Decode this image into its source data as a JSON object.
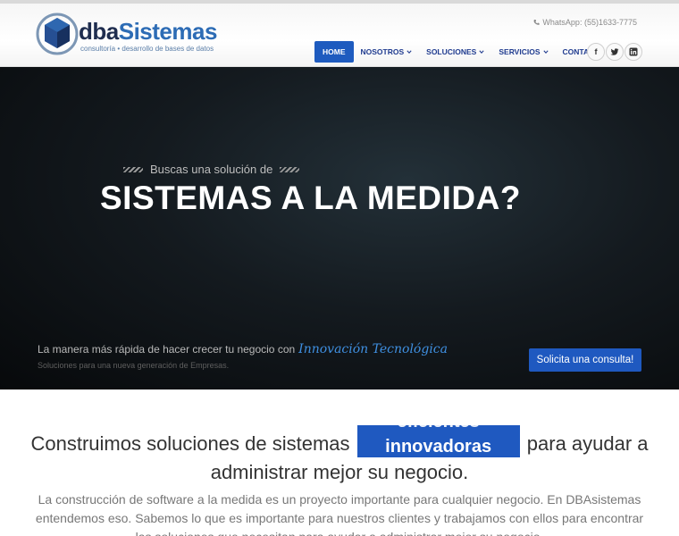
{
  "header": {
    "logo": {
      "name_part1": "dba",
      "name_part2": "Sistemas",
      "tagline": "consultoría • desarrollo de bases de datos"
    },
    "whatsapp_text": "WhatsApp: (55)1633-7775",
    "nav": {
      "items": [
        {
          "label": "HOME",
          "active": true,
          "dropdown": false
        },
        {
          "label": "NOSOTROS",
          "active": false,
          "dropdown": true
        },
        {
          "label": "SOLUCIONES",
          "active": false,
          "dropdown": true
        },
        {
          "label": "SERVICIOS",
          "active": false,
          "dropdown": true
        },
        {
          "label": "CONTACTO",
          "active": false,
          "dropdown": true
        }
      ]
    },
    "social": {
      "facebook": "f",
      "twitter": "t",
      "linkedin": "in"
    }
  },
  "hero": {
    "pre_title": "Buscas una solución de",
    "title": "SISTEMAS A LA MEDIDA?",
    "line": "La manera más rápida de hacer crecer tu negocio con",
    "line_script": "Innovación Tecnológica",
    "subline": "Soluciones para una nueva generación de Empresas.",
    "cta_label": "Solicita una consulta!"
  },
  "intro": {
    "lead_before": "Construimos soluciones de sistemas",
    "rotating_prev": "eficientes",
    "rotating_word": "innovadoras",
    "lead_after": "para ayudar a",
    "lead_line2": "administrar mejor su negocio.",
    "body": "La construcción de software a la medida es un proyecto importante para cualquier negocio. En DBAsistemas entendemos eso. Sabemos lo que es importante para nuestros clientes y trabajamos con ellos para encontrar las soluciones que necesitan para ayudar a administrar mejor su negocio."
  },
  "colors": {
    "brand_blue": "#1f59c0",
    "nav_text": "#1f3b8f",
    "logo_dark": "#1f2d4f",
    "script_blue": "#3f8fe0"
  },
  "icons": {
    "logo": "cube-logo-icon",
    "phone": "phone-icon",
    "chevron": "chevron-down-icon",
    "facebook": "facebook-icon",
    "twitter": "twitter-icon",
    "linkedin": "linkedin-icon"
  }
}
